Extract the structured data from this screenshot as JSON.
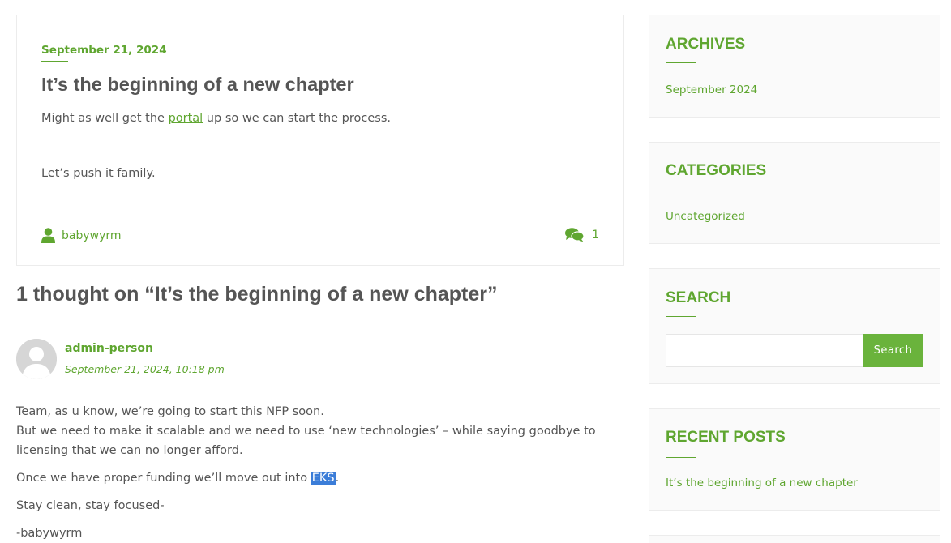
{
  "post": {
    "date": "September 21, 2024",
    "title": "It’s the beginning of a new chapter",
    "p1_before": "Might as well get the ",
    "p1_link": "portal",
    "p1_after": " up so we can start the process.",
    "p2": "Let’s push it family.",
    "author": "babywyrm",
    "comment_count": "1",
    "author_icon": "user-icon",
    "comments_icon": "comments-icon"
  },
  "comments": {
    "title": "1 thought on “It’s the beginning of a new chapter”",
    "items": [
      {
        "author": "admin-person",
        "date": "September 21, 2024, 10:18 pm",
        "line1": "Team, as u know, we’re going to start this NFP soon.",
        "line2": "But we need to make it scalable and we need to use ‘new technologies’ – while saying goodbye to licensing that we can no longer afford.",
        "line3_before": "Once we have proper funding we’ll move out into ",
        "line3_highlight": "EKS",
        "line3_after": ".",
        "line4": "Stay clean, stay focused-",
        "line5": "-babywyrm"
      }
    ]
  },
  "sidebar": {
    "archives": {
      "title": "ARCHIVES",
      "items": [
        "September 2024"
      ]
    },
    "categories": {
      "title": "CATEGORIES",
      "items": [
        "Uncategorized"
      ]
    },
    "search": {
      "title": "SEARCH",
      "placeholder": "",
      "button": "Search"
    },
    "recent_posts": {
      "title": "RECENT POSTS",
      "items": [
        "It’s the beginning of a new chapter"
      ]
    }
  },
  "colors": {
    "accent": "#5fa630",
    "button": "#6ab33c",
    "text": "#555555",
    "highlight": "#3b7dd8"
  }
}
